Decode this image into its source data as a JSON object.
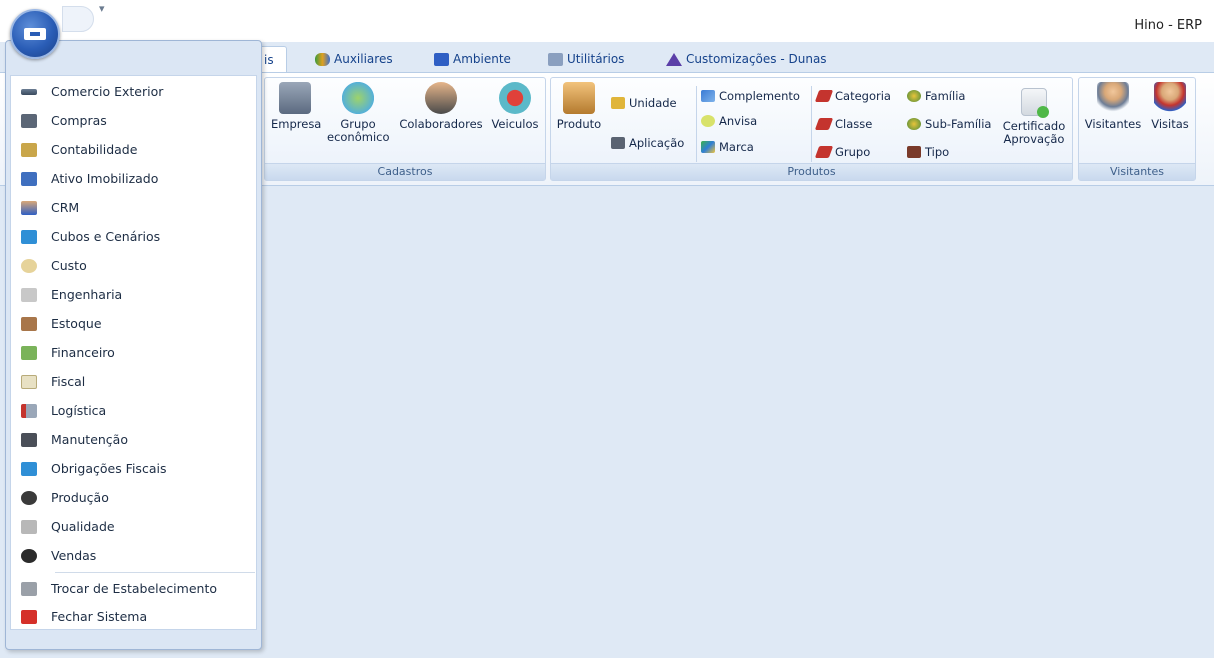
{
  "window": {
    "title": "Hino - ERP"
  },
  "quick_access": {
    "dropdown_glyph": "▾"
  },
  "tabs": [
    {
      "label": "is",
      "active": true
    },
    {
      "label": "Auxiliares"
    },
    {
      "label": "Ambiente"
    },
    {
      "label": "Utilitários"
    },
    {
      "label": "Customizações - Dunas"
    }
  ],
  "ribbon": {
    "cadastros": {
      "label": "Cadastros",
      "buttons": [
        {
          "label": "Empresa"
        },
        {
          "label": "Grupo econômico"
        },
        {
          "label": "Colaboradores"
        },
        {
          "label": "Veiculos"
        }
      ]
    },
    "produtos": {
      "label": "Produtos",
      "produto": "Produto",
      "unidade": "Unidade",
      "aplicacao": "Aplicação",
      "complemento": "Complemento",
      "anvisa": "Anvisa",
      "marca": "Marca",
      "categoria": "Categoria",
      "classe": "Classe",
      "grupo": "Grupo",
      "familia": "Família",
      "sub_familia": "Sub-Família",
      "tipo": "Tipo",
      "certificado": "Certificado Aprovação"
    },
    "visitantes": {
      "label": "Visitantes",
      "visitantes_btn": "Visitantes",
      "visitas_btn": "Visitas"
    }
  },
  "app_menu": {
    "items": [
      "Comercio Exterior",
      "Compras",
      "Contabilidade",
      "Ativo Imobilizado",
      "CRM",
      "Cubos e Cenários",
      "Custo",
      "Engenharia",
      "Estoque",
      "Financeiro",
      "Fiscal",
      "Logística",
      "Manutenção",
      "Obrigações Fiscais",
      "Produção",
      "Qualidade",
      "Vendas"
    ],
    "footer_items": [
      "Trocar de Estabelecimento",
      "Fechar Sistema"
    ]
  },
  "colors": {
    "accent": "#15428b",
    "ribbon_border": "#b8cde6",
    "background": "#dfe9f5"
  }
}
